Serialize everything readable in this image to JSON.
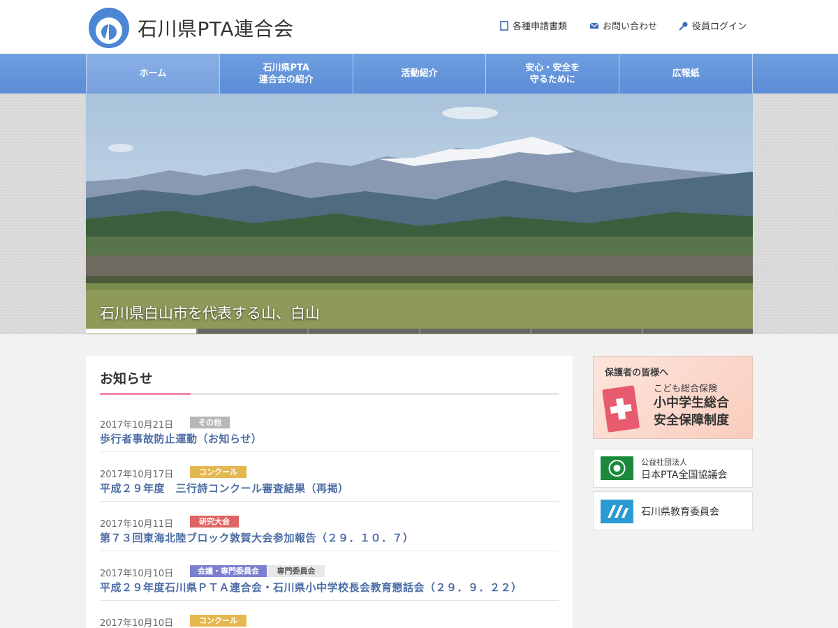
{
  "header": {
    "site_title": "石川県PTA連合会",
    "links": [
      {
        "label": "各種申請書類",
        "icon": "document-icon"
      },
      {
        "label": "お問い合わせ",
        "icon": "mail-icon"
      },
      {
        "label": "役員ログイン",
        "icon": "key-icon"
      }
    ]
  },
  "nav": {
    "items": [
      {
        "label": "ホーム"
      },
      {
        "label": "石川県PTA\n連合会の紹介"
      },
      {
        "label": "活動紹介"
      },
      {
        "label": "安心・安全を\n守るために"
      },
      {
        "label": "広報紙"
      }
    ],
    "active_index": 0
  },
  "hero": {
    "caption": "石川県白山市を代表する山、白山",
    "slide_count": 6,
    "active_slide": 0
  },
  "news": {
    "title": "お知らせ",
    "items": [
      {
        "date": "2017年10月21日",
        "tags": [
          {
            "label": "その他",
            "color": "#b8b8b8"
          }
        ],
        "title": "歩行者事故防止運動（お知らせ）"
      },
      {
        "date": "2017年10月17日",
        "tags": [
          {
            "label": "コンクール",
            "color": "#e5b84f"
          }
        ],
        "title": "平成２９年度　三行詩コンクール審査結果（再掲）"
      },
      {
        "date": "2017年10月11日",
        "tags": [
          {
            "label": "研究大会",
            "color": "#e06464"
          }
        ],
        "title": "第７３回東海北陸ブロック敦賀大会参加報告（２９．１０．７）"
      },
      {
        "date": "2017年10月10日",
        "tags": [
          {
            "label": "会議・専門委員会",
            "color": "#7b7fcf"
          },
          {
            "label": "専門委員会",
            "color": "#e8e8e8"
          }
        ],
        "title": "平成２９年度石川県ＰＴＡ連合会・石川県小中学校長会教育懇話会（２９．９．２２）"
      },
      {
        "date": "2017年10月10日",
        "tags": [
          {
            "label": "コンクール",
            "color": "#e5b84f"
          }
        ],
        "title": ""
      }
    ]
  },
  "sidebar": {
    "insurance": {
      "lead": "保護者の皆様へ",
      "sub": "こども総合保険",
      "main": "小中学生総合\n安全保障制度"
    },
    "links": [
      {
        "line1": "公益社団法人",
        "line2": "日本PTA全国協議会"
      },
      {
        "line1": "石川県教育委員会"
      }
    ]
  },
  "colors": {
    "nav": "#5b8cd6",
    "link": "#4d6da6",
    "accent_rule": "#ef8aa5"
  }
}
